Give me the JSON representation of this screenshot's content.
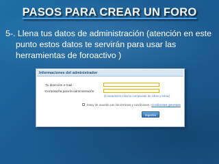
{
  "slide": {
    "title": "PASOS PARA CREAR UN FORO",
    "body": "5-. Llena tus datos de administración (atención en este punto estos datos te servirán para usar las herramientas de foroactivo )"
  },
  "form": {
    "header": "Informaciones del administrador",
    "email_label": "Tu dirección e-mail :",
    "password_label": "Contraseña para la administración:",
    "password_hint": "(6 caracteres mínimo compuesto de cifras y letras)",
    "terms_text": "Estoy de acuerdo con los términos y condiciones :",
    "terms_link": "Condiciones generales",
    "register_button": "registrar"
  },
  "colors": {
    "background": "#1b5c92",
    "title_underline": "#4fa0e4",
    "field_border": "#d7b400",
    "button": "#2f6fae"
  }
}
